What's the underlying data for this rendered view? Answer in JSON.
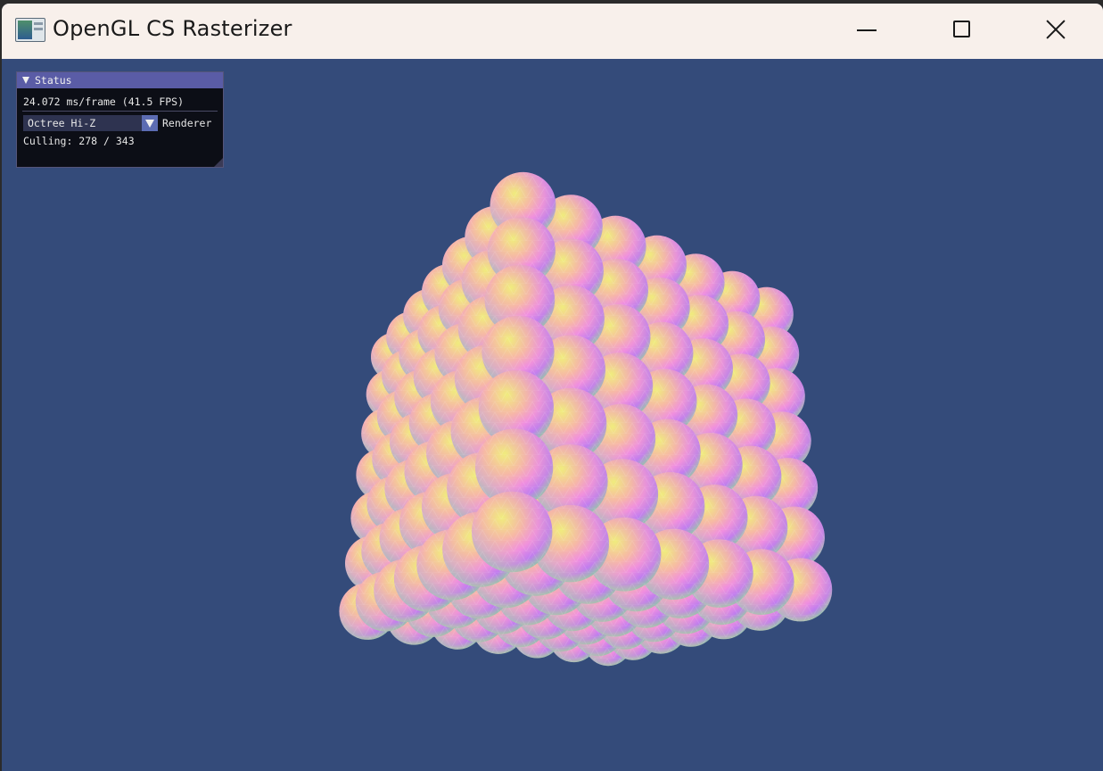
{
  "window": {
    "title": "OpenGL CS Rasterizer",
    "controls": [
      "minimize",
      "maximize",
      "close"
    ]
  },
  "status_panel": {
    "header": "Status",
    "fps_text": "24.072 ms/frame (41.5 FPS)",
    "renderer_select": {
      "value": "Octree Hi-Z",
      "label": "Renderer"
    },
    "culling_text": "Culling: 278 / 343"
  },
  "scene": {
    "background_color": "#344b7a",
    "grid_size": 7,
    "object": "icosphere",
    "shading": "normal-colored"
  }
}
